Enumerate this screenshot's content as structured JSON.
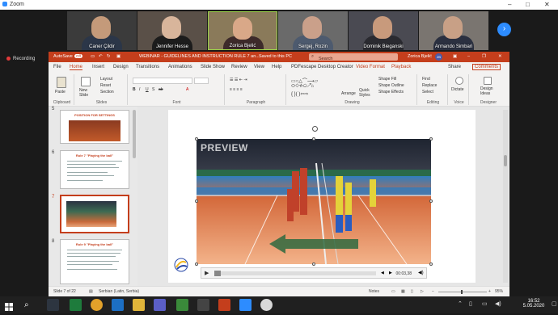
{
  "zoom": {
    "title": "Zoom",
    "recording_label": "Recording",
    "participants": [
      {
        "name": "Caner Çildir"
      },
      {
        "name": "Jennifer Hesse"
      },
      {
        "name": "Zorica Bjelić"
      },
      {
        "name": "Sergej, Rozin"
      },
      {
        "name": "Dominik Bieganski"
      },
      {
        "name": "Armando Simbari"
      }
    ],
    "next_arrow": "›"
  },
  "ppt": {
    "autosave": "AutoSave",
    "autosave_state": "Off",
    "doc_title": "WEBINAR - GUIDELINES AND INSTRUCTION RULE 7 an...",
    "saved_state": "Saved to this PC",
    "search_placeholder": "Search",
    "user": "Zorica Bjelić",
    "user_initials": "ZB",
    "tabs": [
      "File",
      "Home",
      "Insert",
      "Design",
      "Transitions",
      "Animations",
      "Slide Show",
      "Review",
      "View",
      "Help",
      "PDFescape Desktop Creator",
      "Video Format",
      "Playback"
    ],
    "active_tab": "Home",
    "share": "Share",
    "comments": "Comments",
    "ribbon": {
      "clipboard": "Clipboard",
      "paste": "Paste",
      "slides": "Slides",
      "new_slide": "New Slide",
      "layout": "Layout",
      "reset": "Reset",
      "section": "Section",
      "font": "Font",
      "paragraph": "Paragraph",
      "drawing": "Drawing",
      "arrange": "Arrange",
      "quick_styles": "Quick Styles",
      "shape_fill": "Shape Fill",
      "shape_outline": "Shape Outline",
      "shape_effects": "Shape Effects",
      "editing": "Editing",
      "find": "Find",
      "replace": "Replace",
      "select": "Select",
      "voice": "Voice",
      "dictate": "Dictate",
      "designer": "Designer",
      "design_ideas": "Design Ideas"
    },
    "thumbnails": [
      {
        "num": "5",
        "title": "POSITION FOR SETTINGS"
      },
      {
        "num": "6",
        "title": "Rule 7 \"Playing the ball\""
      },
      {
        "num": "7",
        "title": ""
      },
      {
        "num": "8",
        "title": "Rule 9 \"Playing the ball\""
      }
    ],
    "video": {
      "preview_label": "PREVIEW",
      "time": "00:03,38"
    },
    "status": {
      "slide_info": "Slide 7 of 22",
      "language": "Serbian (Latin, Serbia)",
      "notes": "Notes",
      "zoom": "95%"
    }
  },
  "taskbar": {
    "time": "16:52",
    "date": "5.05.2020"
  }
}
